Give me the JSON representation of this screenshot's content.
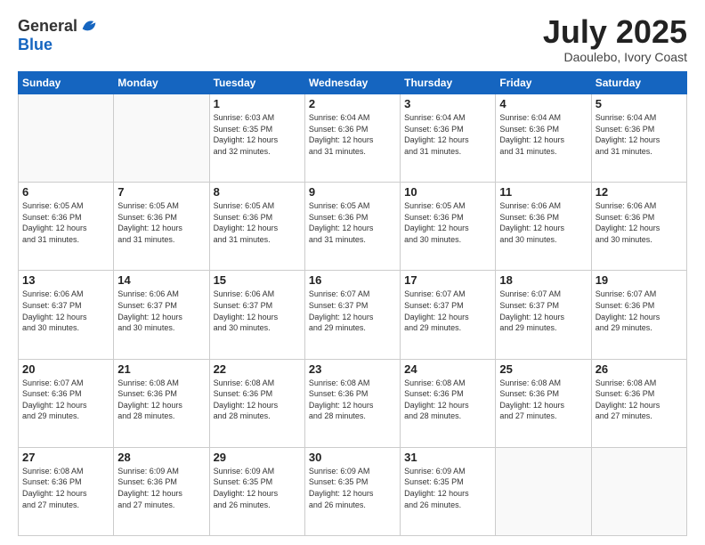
{
  "logo": {
    "general": "General",
    "blue": "Blue"
  },
  "header": {
    "month": "July 2025",
    "location": "Daoulebo, Ivory Coast"
  },
  "days_of_week": [
    "Sunday",
    "Monday",
    "Tuesday",
    "Wednesday",
    "Thursday",
    "Friday",
    "Saturday"
  ],
  "weeks": [
    [
      {
        "day": "",
        "info": ""
      },
      {
        "day": "",
        "info": ""
      },
      {
        "day": "1",
        "info": "Sunrise: 6:03 AM\nSunset: 6:35 PM\nDaylight: 12 hours\nand 32 minutes."
      },
      {
        "day": "2",
        "info": "Sunrise: 6:04 AM\nSunset: 6:36 PM\nDaylight: 12 hours\nand 31 minutes."
      },
      {
        "day": "3",
        "info": "Sunrise: 6:04 AM\nSunset: 6:36 PM\nDaylight: 12 hours\nand 31 minutes."
      },
      {
        "day": "4",
        "info": "Sunrise: 6:04 AM\nSunset: 6:36 PM\nDaylight: 12 hours\nand 31 minutes."
      },
      {
        "day": "5",
        "info": "Sunrise: 6:04 AM\nSunset: 6:36 PM\nDaylight: 12 hours\nand 31 minutes."
      }
    ],
    [
      {
        "day": "6",
        "info": "Sunrise: 6:05 AM\nSunset: 6:36 PM\nDaylight: 12 hours\nand 31 minutes."
      },
      {
        "day": "7",
        "info": "Sunrise: 6:05 AM\nSunset: 6:36 PM\nDaylight: 12 hours\nand 31 minutes."
      },
      {
        "day": "8",
        "info": "Sunrise: 6:05 AM\nSunset: 6:36 PM\nDaylight: 12 hours\nand 31 minutes."
      },
      {
        "day": "9",
        "info": "Sunrise: 6:05 AM\nSunset: 6:36 PM\nDaylight: 12 hours\nand 31 minutes."
      },
      {
        "day": "10",
        "info": "Sunrise: 6:05 AM\nSunset: 6:36 PM\nDaylight: 12 hours\nand 30 minutes."
      },
      {
        "day": "11",
        "info": "Sunrise: 6:06 AM\nSunset: 6:36 PM\nDaylight: 12 hours\nand 30 minutes."
      },
      {
        "day": "12",
        "info": "Sunrise: 6:06 AM\nSunset: 6:36 PM\nDaylight: 12 hours\nand 30 minutes."
      }
    ],
    [
      {
        "day": "13",
        "info": "Sunrise: 6:06 AM\nSunset: 6:37 PM\nDaylight: 12 hours\nand 30 minutes."
      },
      {
        "day": "14",
        "info": "Sunrise: 6:06 AM\nSunset: 6:37 PM\nDaylight: 12 hours\nand 30 minutes."
      },
      {
        "day": "15",
        "info": "Sunrise: 6:06 AM\nSunset: 6:37 PM\nDaylight: 12 hours\nand 30 minutes."
      },
      {
        "day": "16",
        "info": "Sunrise: 6:07 AM\nSunset: 6:37 PM\nDaylight: 12 hours\nand 29 minutes."
      },
      {
        "day": "17",
        "info": "Sunrise: 6:07 AM\nSunset: 6:37 PM\nDaylight: 12 hours\nand 29 minutes."
      },
      {
        "day": "18",
        "info": "Sunrise: 6:07 AM\nSunset: 6:37 PM\nDaylight: 12 hours\nand 29 minutes."
      },
      {
        "day": "19",
        "info": "Sunrise: 6:07 AM\nSunset: 6:36 PM\nDaylight: 12 hours\nand 29 minutes."
      }
    ],
    [
      {
        "day": "20",
        "info": "Sunrise: 6:07 AM\nSunset: 6:36 PM\nDaylight: 12 hours\nand 29 minutes."
      },
      {
        "day": "21",
        "info": "Sunrise: 6:08 AM\nSunset: 6:36 PM\nDaylight: 12 hours\nand 28 minutes."
      },
      {
        "day": "22",
        "info": "Sunrise: 6:08 AM\nSunset: 6:36 PM\nDaylight: 12 hours\nand 28 minutes."
      },
      {
        "day": "23",
        "info": "Sunrise: 6:08 AM\nSunset: 6:36 PM\nDaylight: 12 hours\nand 28 minutes."
      },
      {
        "day": "24",
        "info": "Sunrise: 6:08 AM\nSunset: 6:36 PM\nDaylight: 12 hours\nand 28 minutes."
      },
      {
        "day": "25",
        "info": "Sunrise: 6:08 AM\nSunset: 6:36 PM\nDaylight: 12 hours\nand 27 minutes."
      },
      {
        "day": "26",
        "info": "Sunrise: 6:08 AM\nSunset: 6:36 PM\nDaylight: 12 hours\nand 27 minutes."
      }
    ],
    [
      {
        "day": "27",
        "info": "Sunrise: 6:08 AM\nSunset: 6:36 PM\nDaylight: 12 hours\nand 27 minutes."
      },
      {
        "day": "28",
        "info": "Sunrise: 6:09 AM\nSunset: 6:36 PM\nDaylight: 12 hours\nand 27 minutes."
      },
      {
        "day": "29",
        "info": "Sunrise: 6:09 AM\nSunset: 6:35 PM\nDaylight: 12 hours\nand 26 minutes."
      },
      {
        "day": "30",
        "info": "Sunrise: 6:09 AM\nSunset: 6:35 PM\nDaylight: 12 hours\nand 26 minutes."
      },
      {
        "day": "31",
        "info": "Sunrise: 6:09 AM\nSunset: 6:35 PM\nDaylight: 12 hours\nand 26 minutes."
      },
      {
        "day": "",
        "info": ""
      },
      {
        "day": "",
        "info": ""
      }
    ]
  ]
}
